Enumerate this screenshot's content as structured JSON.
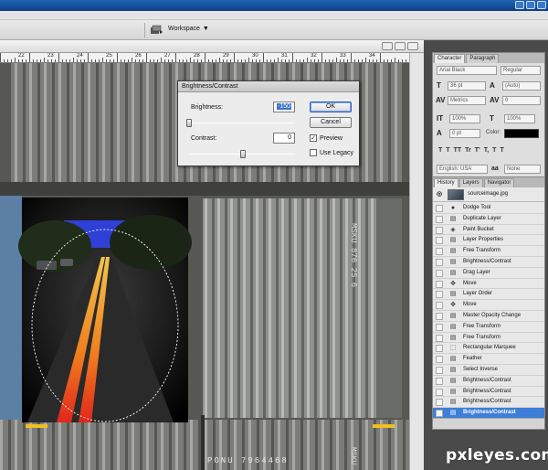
{
  "workspace": {
    "label": "Workspace"
  },
  "ruler": {
    "labels": [
      "22",
      "23",
      "24",
      "25",
      "26",
      "27",
      "28",
      "29",
      "30",
      "31",
      "32",
      "33",
      "34"
    ]
  },
  "character_panel": {
    "tabs": [
      {
        "label": "Character"
      },
      {
        "label": "Paragraph"
      }
    ],
    "font_family": "Arial Black",
    "font_style": "Regular",
    "font_size": "36 pt",
    "leading": "(Auto)",
    "kerning": "Metrics",
    "tracking": "0",
    "vertical_scale": "100%",
    "horizontal_scale": "100%",
    "baseline_shift": "0 pt",
    "color_label": "Color:",
    "color_value": "#000000",
    "type_styles": [
      "T",
      "T",
      "TT",
      "Tr",
      "T'",
      "T,",
      "T",
      "T"
    ],
    "language": "English: USA",
    "aa_symbol": "aa",
    "antialias": "None"
  },
  "history_panel": {
    "tabs": [
      {
        "label": "History"
      },
      {
        "label": "Layers"
      },
      {
        "label": "Navigator"
      }
    ],
    "snapshot": {
      "name": "sourceimage.jpg"
    },
    "items": [
      {
        "label": "Dodge Tool",
        "icon": "dodge-icon"
      },
      {
        "label": "Duplicate Layer",
        "icon": "layer-icon"
      },
      {
        "label": "Paint Bucket",
        "icon": "bucket-icon"
      },
      {
        "label": "Layer Properties",
        "icon": "layer-icon"
      },
      {
        "label": "Free Transform",
        "icon": "layer-icon"
      },
      {
        "label": "Brightness/Contrast",
        "icon": "layer-icon"
      },
      {
        "label": "Drag Layer",
        "icon": "layer-icon"
      },
      {
        "label": "Move",
        "icon": "move-icon"
      },
      {
        "label": "Layer Order",
        "icon": "layer-icon"
      },
      {
        "label": "Move",
        "icon": "move-icon"
      },
      {
        "label": "Master Opacity Change",
        "icon": "layer-icon"
      },
      {
        "label": "Free Transform",
        "icon": "layer-icon"
      },
      {
        "label": "Free Transform",
        "icon": "layer-icon"
      },
      {
        "label": "Rectangular Marquee",
        "icon": "marquee-icon"
      },
      {
        "label": "Feather",
        "icon": "layer-icon"
      },
      {
        "label": "Select Inverse",
        "icon": "layer-icon"
      },
      {
        "label": "Brightness/Contrast",
        "icon": "layer-icon"
      },
      {
        "label": "Brightness/Contrast",
        "icon": "layer-icon"
      },
      {
        "label": "Brightness/Contrast",
        "icon": "layer-icon"
      },
      {
        "label": "Brightness/Contrast",
        "icon": "layer-icon",
        "selected": true
      }
    ]
  },
  "dialog": {
    "title": "Brightness/Contrast",
    "brightness_label": "Brightness:",
    "brightness_value": "-150",
    "contrast_label": "Contrast:",
    "contrast_value": "0",
    "ok_label": "OK",
    "cancel_label": "Cancel",
    "preview_label": "Preview",
    "preview_checked": true,
    "legacy_label": "Use Legacy",
    "legacy_checked": false
  },
  "canvas": {
    "container_text_top": "MSKU 876 25 6",
    "container_plate": "PONU 7964468",
    "container_text_bottom": "MSKU"
  },
  "watermark": {
    "text": "pxleyes.com"
  }
}
